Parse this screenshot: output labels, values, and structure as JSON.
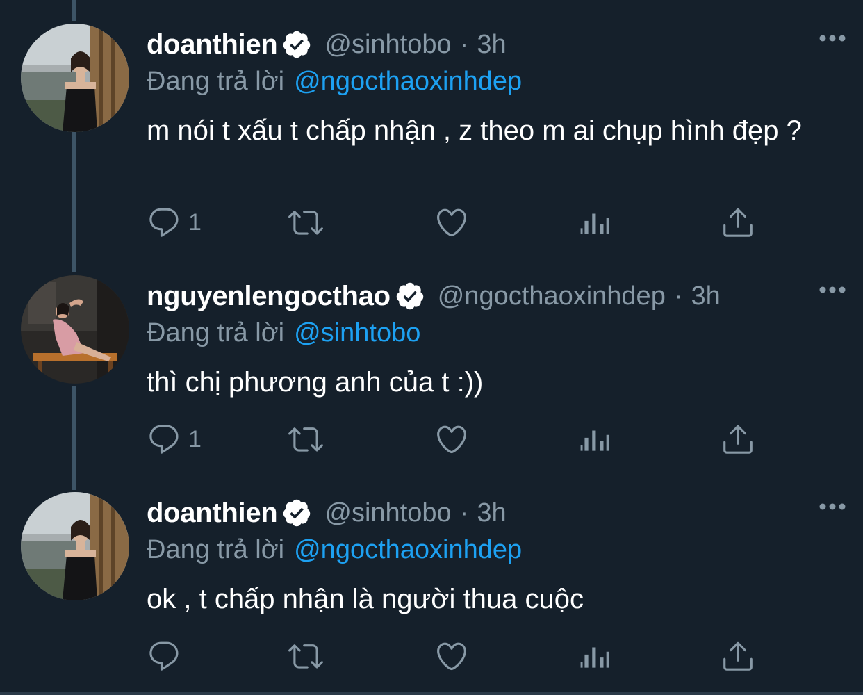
{
  "tweets": [
    {
      "display_name": "doanthien",
      "handle": "@sinhtobo",
      "separator": "·",
      "time": "3h",
      "replying_label": "Đang trả lời",
      "replying_to": "@ngocthaoxinhdep",
      "text": "m nói t xấu t chấp nhận , z theo m ai chụp hình đẹp ?",
      "reply_count": "1"
    },
    {
      "display_name": "nguyenlengocthao",
      "handle": "@ngocthaoxinhdep",
      "separator": "·",
      "time": "3h",
      "replying_label": "Đang trả lời",
      "replying_to": "@sinhtobo",
      "text": "thì chị phương anh của t :))",
      "reply_count": "1"
    },
    {
      "display_name": "doanthien",
      "handle": "@sinhtobo",
      "separator": "·",
      "time": "3h",
      "replying_label": "Đang trả lời",
      "replying_to": "@ngocthaoxinhdep",
      "text": "ok , t chấp nhận là người thua cuộc",
      "reply_count": ""
    }
  ],
  "icons": {
    "verified": "verified-badge-icon",
    "more": "more-options-icon",
    "reply": "reply-icon",
    "retweet": "retweet-icon",
    "like": "like-icon",
    "analytics": "analytics-icon",
    "share": "share-icon"
  },
  "colors": {
    "background": "#15202b",
    "text": "#ffffff",
    "secondary": "#8899a6",
    "accent": "#1da1f2",
    "thread_line": "#3d5466"
  }
}
